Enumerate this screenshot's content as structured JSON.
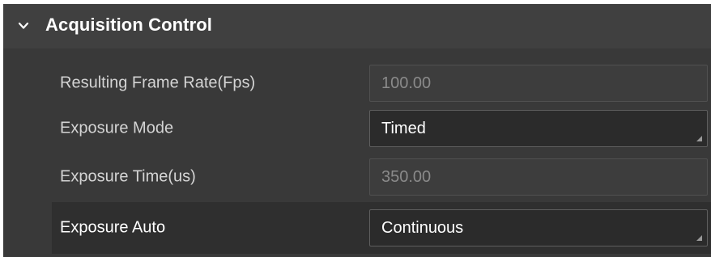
{
  "section": {
    "title": "Acquisition Control",
    "icon": "chevron-down-icon",
    "expanded": true
  },
  "rows": [
    {
      "label": "Resulting Frame Rate(Fps)",
      "value": "100.00",
      "kind": "readonly"
    },
    {
      "label": "Exposure Mode",
      "value": "Timed",
      "kind": "combo"
    },
    {
      "label": "Exposure Time(us)",
      "value": "350.00",
      "kind": "readonly"
    },
    {
      "label": "Exposure Auto",
      "value": "Continuous",
      "kind": "combo",
      "selected": true
    }
  ],
  "colors": {
    "panel_bg": "#393939",
    "header_bg": "#404040",
    "selected_row_bg": "#2f2f2f",
    "text_primary": "#ffffff",
    "text_label": "#d4d4d4",
    "text_disabled": "#8a8a8a"
  }
}
